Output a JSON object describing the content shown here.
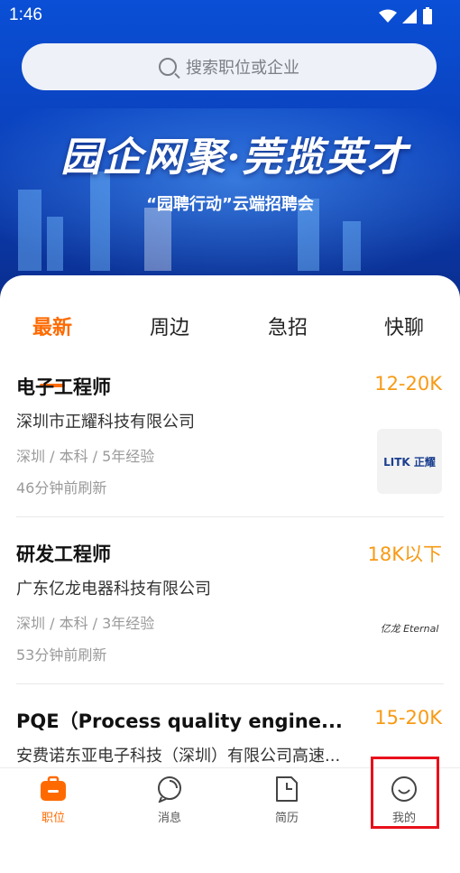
{
  "status_bar": {
    "time": "1:46"
  },
  "search": {
    "placeholder": "搜索职位或企业"
  },
  "banner": {
    "headline": "园企网聚·莞揽英才",
    "subline": "“园聘行动”云端招聘会"
  },
  "tabs": [
    {
      "label": "最新",
      "active": true
    },
    {
      "label": "周边",
      "active": false
    },
    {
      "label": "急招",
      "active": false
    },
    {
      "label": "快聊",
      "active": false
    }
  ],
  "jobs": [
    {
      "title": "电子工程师",
      "salary": "12-20K",
      "company": "深圳市正耀科技有限公司",
      "meta": "深圳 / 本科 / 5年经验",
      "refresh": "46分钟前刷新",
      "logo_text": "LITK 正耀"
    },
    {
      "title": "研发工程师",
      "salary": "18K以下",
      "company": "广东亿龙电器科技有限公司",
      "meta": "深圳 / 本科 / 3年经验",
      "refresh": "53分钟前刷新",
      "logo_text": "亿龙 Eternal"
    },
    {
      "title": "PQE（Process quality engine...",
      "salary": "15-20K",
      "company": "安费诺东亚电子科技（深圳）有限公司高速...",
      "meta": "",
      "refresh": "",
      "logo_text": ""
    }
  ],
  "bottom_nav": [
    {
      "label": "职位",
      "icon": "briefcase-icon",
      "active": true
    },
    {
      "label": "消息",
      "icon": "chat-icon",
      "active": false
    },
    {
      "label": "简历",
      "icon": "resume-icon",
      "active": false
    },
    {
      "label": "我的",
      "icon": "profile-icon",
      "active": false
    }
  ],
  "colors": {
    "accent": "#ff6a00",
    "salary": "#f89a14",
    "banner": "#0a4fd6",
    "highlight": "#e8101b"
  }
}
